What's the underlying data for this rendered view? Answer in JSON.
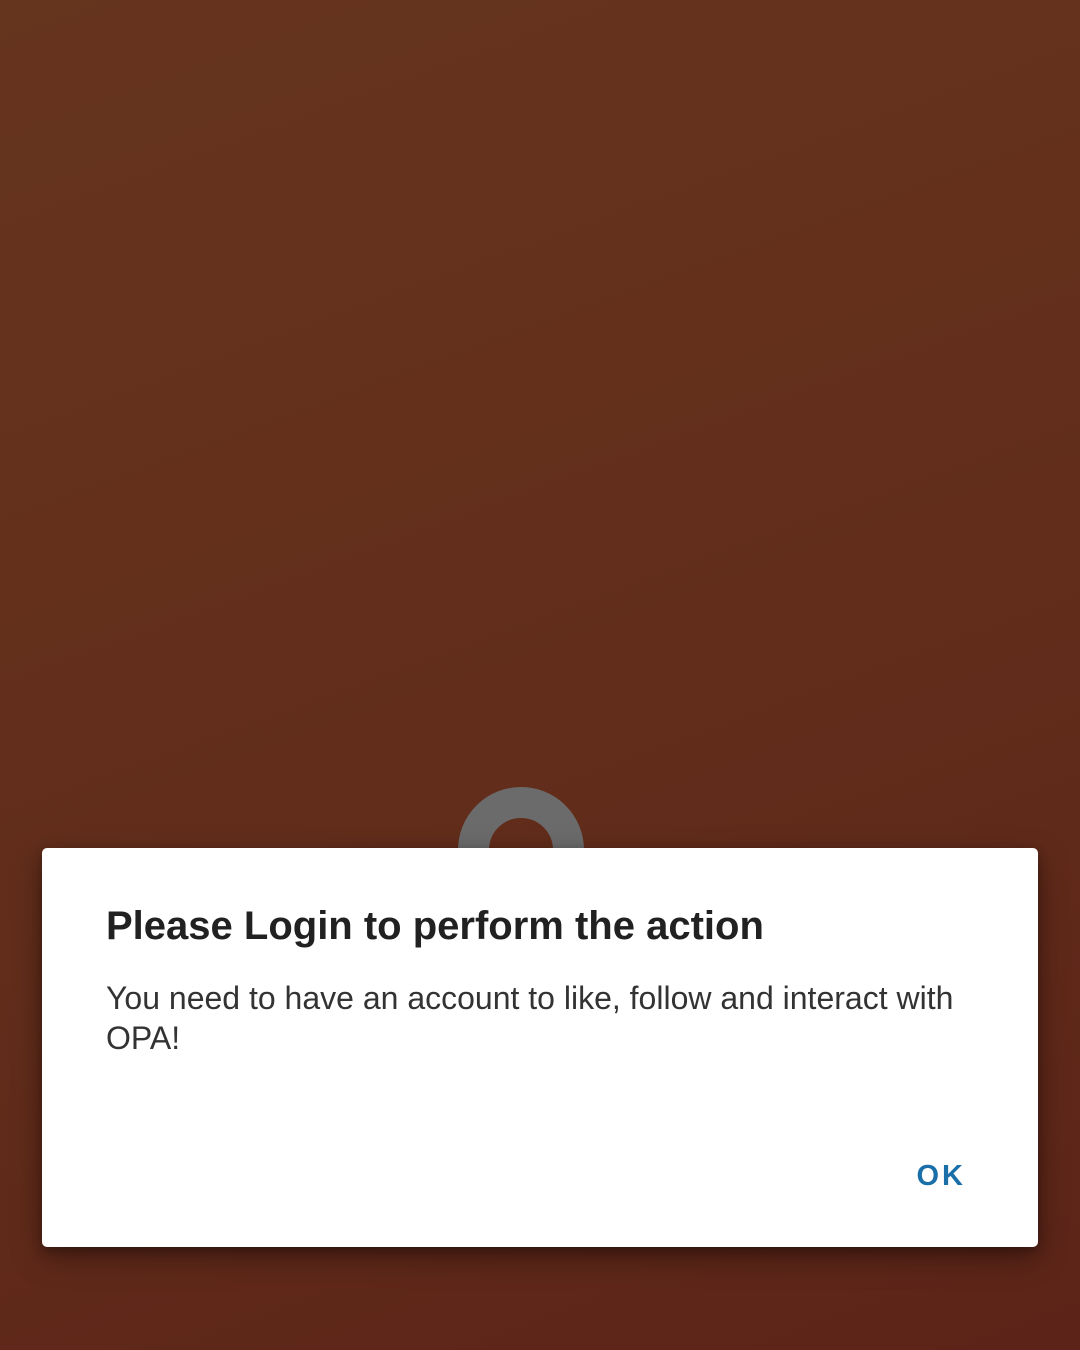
{
  "background": {
    "color": "#622d1b"
  },
  "loading": {
    "icon": "loading-spinner-icon"
  },
  "dialog": {
    "title": "Please Login to perform the action",
    "message": "You need to have an account to like, follow and interact with OPA!",
    "ok_label": "OK",
    "accent_color": "#1b6fa8"
  }
}
